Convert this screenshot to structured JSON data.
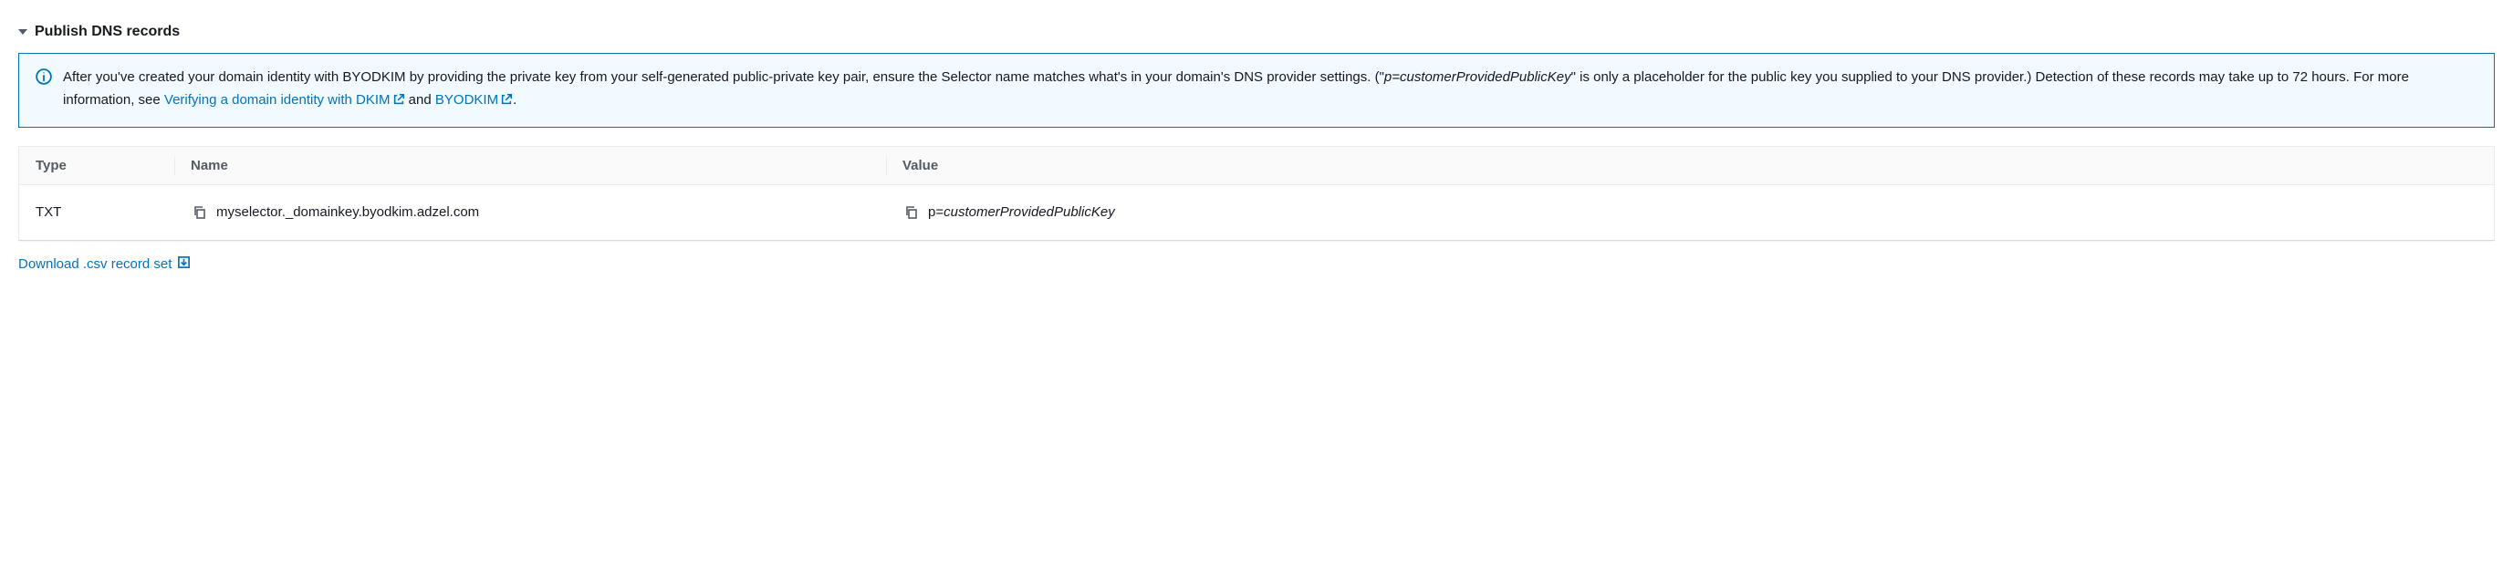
{
  "header": {
    "title": "Publish DNS records"
  },
  "alert": {
    "text_before_placeholder": "After you've created your domain identity with BYODKIM by providing the private key from your self-generated public-private key pair, ensure the Selector name matches what's in your domain's DNS provider settings. (\"",
    "placeholder_em": "p=customerProvidedPublicKey",
    "text_mid": "\" is only a placeholder for the public key you supplied to your DNS provider.) Detection of these records may take up to 72 hours. For more information, see ",
    "link1_text": "Verifying a domain identity with DKIM",
    "and_text": " and ",
    "link2_text": "BYODKIM",
    "period": "."
  },
  "table": {
    "headers": {
      "type": "Type",
      "name": "Name",
      "value": "Value"
    },
    "row": {
      "type": "TXT",
      "name": "myselector._domainkey.byodkim.adzel.com",
      "value_prefix": "p=",
      "value_em": "customerProvidedPublicKey"
    }
  },
  "download": {
    "label": "Download .csv record set"
  }
}
